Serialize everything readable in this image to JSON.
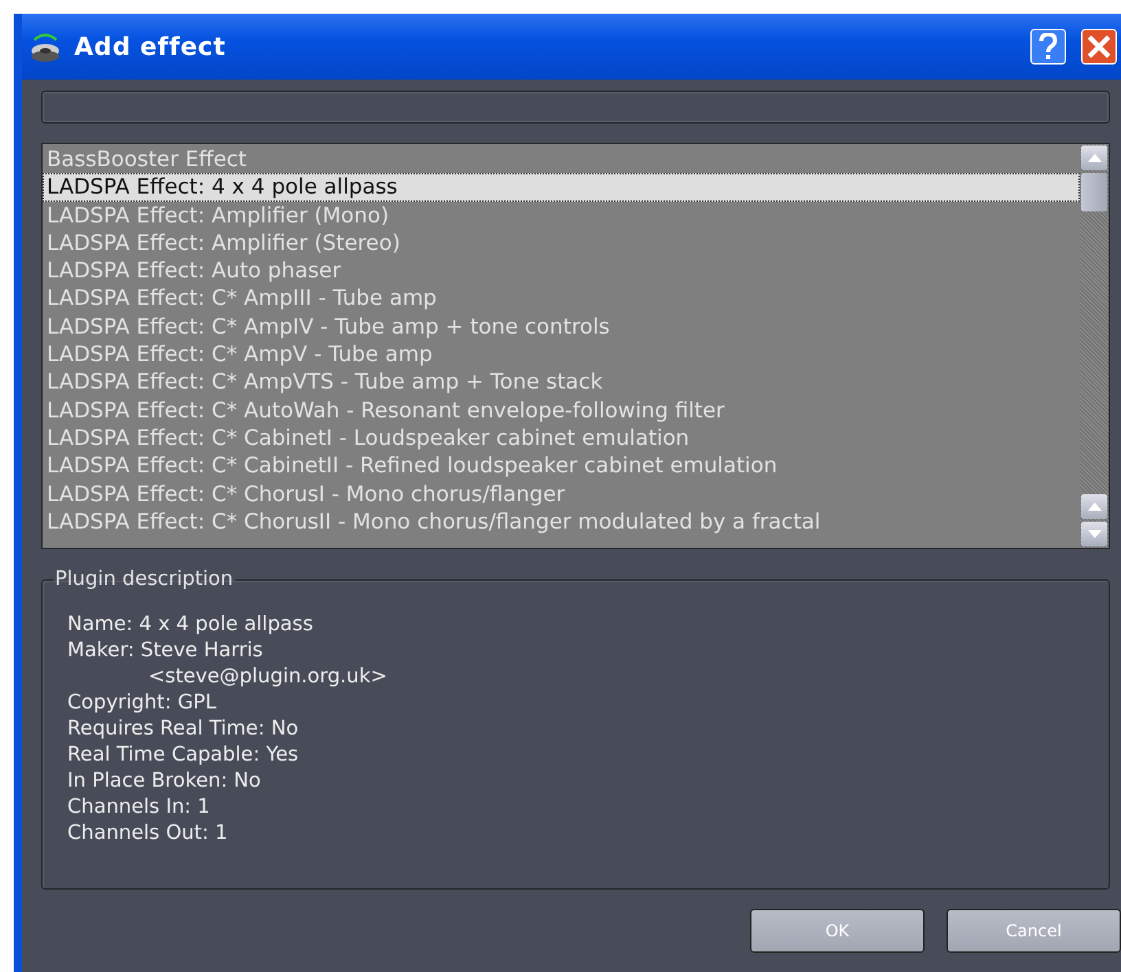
{
  "window": {
    "title": "Add effect"
  },
  "effects": [
    {
      "label": "BassBooster Effect",
      "selected": false
    },
    {
      "label": "LADSPA Effect: 4 x 4 pole allpass",
      "selected": true
    },
    {
      "label": "LADSPA Effect: Amplifier (Mono)",
      "selected": false
    },
    {
      "label": "LADSPA Effect: Amplifier (Stereo)",
      "selected": false
    },
    {
      "label": "LADSPA Effect: Auto phaser",
      "selected": false
    },
    {
      "label": "LADSPA Effect: C* AmpIII - Tube amp",
      "selected": false
    },
    {
      "label": "LADSPA Effect: C* AmpIV - Tube amp + tone controls",
      "selected": false
    },
    {
      "label": "LADSPA Effect: C* AmpV - Tube amp",
      "selected": false
    },
    {
      "label": "LADSPA Effect: C* AmpVTS - Tube amp + Tone stack",
      "selected": false
    },
    {
      "label": "LADSPA Effect: C* AutoWah - Resonant envelope-following filter",
      "selected": false
    },
    {
      "label": "LADSPA Effect: C* CabinetI - Loudspeaker cabinet emulation",
      "selected": false
    },
    {
      "label": "LADSPA Effect: C* CabinetII - Refined loudspeaker cabinet emulation",
      "selected": false
    },
    {
      "label": "LADSPA Effect: C* ChorusI - Mono chorus/flanger",
      "selected": false
    },
    {
      "label": "LADSPA Effect: C* ChorusII - Mono chorus/flanger modulated by a fractal",
      "selected": false
    }
  ],
  "description": {
    "title": "Plugin description",
    "lines": [
      {
        "text": "Name: 4 x 4 pole allpass",
        "indented": false
      },
      {
        "text": "Maker: Steve Harris",
        "indented": false
      },
      {
        "text": "<steve@plugin.org.uk>",
        "indented": true
      },
      {
        "text": "Copyright: GPL",
        "indented": false
      },
      {
        "text": "Requires Real Time: No",
        "indented": false
      },
      {
        "text": "Real Time Capable: Yes",
        "indented": false
      },
      {
        "text": "In Place Broken: No",
        "indented": false
      },
      {
        "text": "Channels In: 1",
        "indented": false
      },
      {
        "text": "Channels Out: 1",
        "indented": false
      }
    ]
  },
  "buttons": [
    "OK",
    "Cancel"
  ]
}
